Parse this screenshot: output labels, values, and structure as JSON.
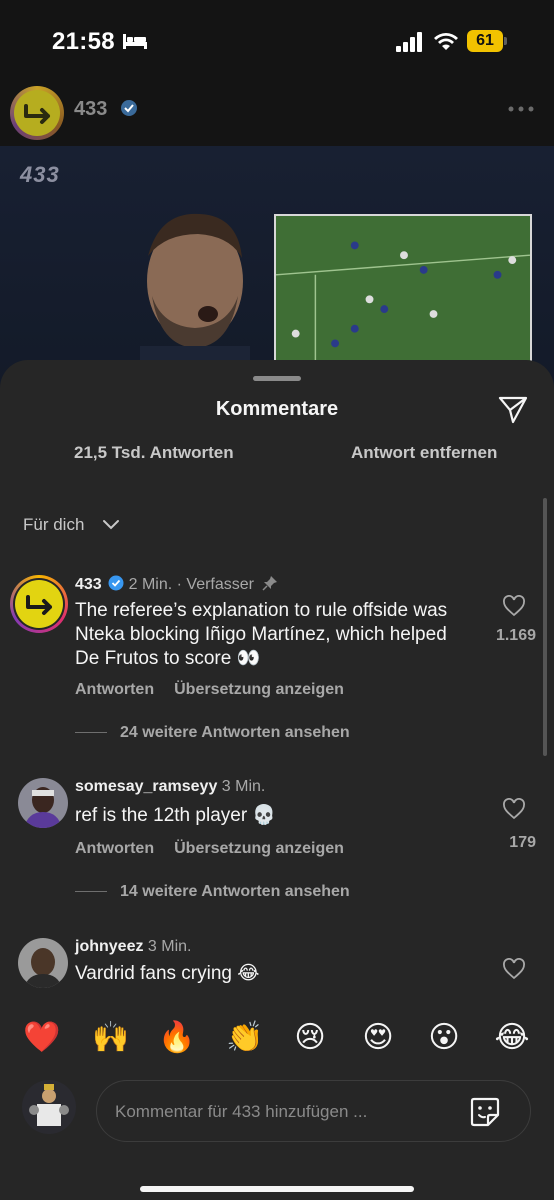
{
  "status_bar": {
    "time": "21:58",
    "battery": "61",
    "battery_color": "#f2c200",
    "icons": [
      "bed-icon",
      "signal-icon",
      "wifi-icon",
      "battery-icon"
    ]
  },
  "post": {
    "username": "433",
    "verified": true,
    "media_logo": "433"
  },
  "sheet": {
    "title": "Kommentare",
    "reply_count": "21,5 Tsd. Antworten",
    "remove_reply": "Antwort entfernen",
    "filter_label": "Für dich"
  },
  "comments": [
    {
      "username": "433",
      "time": "2 Min.",
      "author_label": "· Verfasser",
      "text": "The referee’s explanation to rule offside was Nteka blocking Iñigo Martínez, which helped De Frutos to score 👀",
      "reply_label": "Antworten",
      "translate_label": "Übersetzung anzeigen",
      "likes": "1.169",
      "more_replies": "24 weitere Antworten ansehen"
    },
    {
      "username": "somesay_ramseyy",
      "time": "3 Min.",
      "text": "ref is the 12th player 💀",
      "reply_label": "Antworten",
      "translate_label": "Übersetzung anzeigen",
      "likes": "179",
      "more_replies": "14 weitere Antworten ansehen"
    },
    {
      "username": "johnyeez",
      "time": "3 Min.",
      "text": "Vardrid fans crying 😂"
    }
  ],
  "emoji_bar": [
    "❤️",
    "🙌",
    "🔥",
    "👏",
    "😢",
    "😍",
    "😮",
    "😂"
  ],
  "composer": {
    "placeholder": "Kommentar für 433 hinzufügen ..."
  },
  "colors": {
    "sheet_background": "#262626",
    "verified_blue": "#3897f0",
    "text_secondary": "#a8a8a8"
  }
}
